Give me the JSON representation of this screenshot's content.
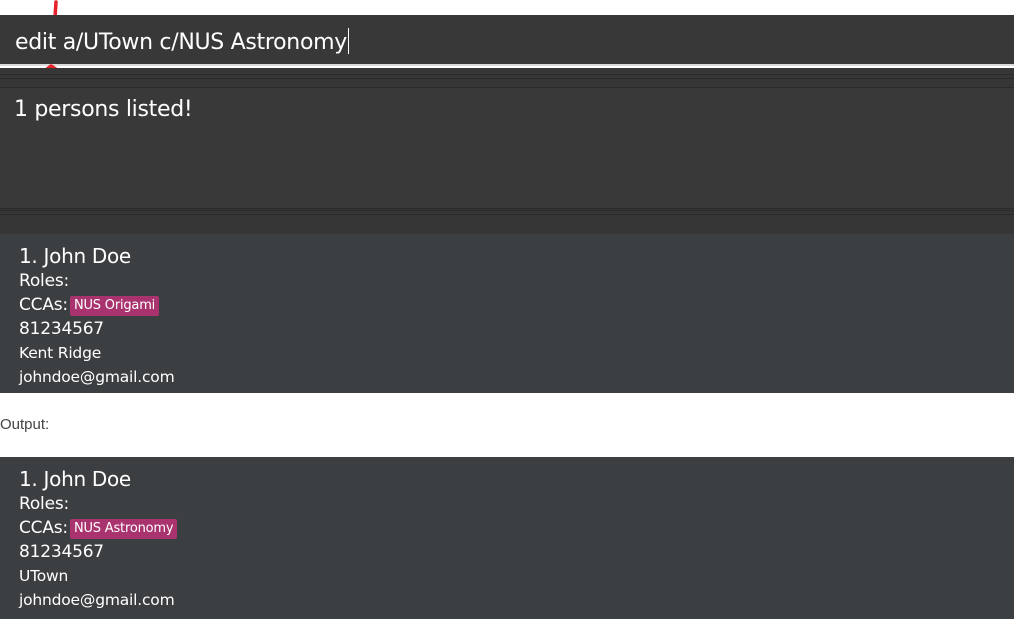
{
  "command": {
    "value": "edit a/UTown c/NUS Astronomy"
  },
  "result": {
    "message": "1 persons listed!"
  },
  "before_card": {
    "index_name": "1.  John Doe",
    "roles_label": "Roles:",
    "ccas_label": "CCAs:",
    "cca_tag": "NUS Origami",
    "phone": "81234567",
    "address": "Kent Ridge",
    "email": "johndoe@gmail.com"
  },
  "output_label": "Output:",
  "after_card": {
    "index_name": "1.  John Doe",
    "roles_label": "Roles:",
    "ccas_label": "CCAs:",
    "cca_tag": "NUS Astronomy",
    "phone": "81234567",
    "address": "UTown",
    "email": "johndoe@gmail.com"
  },
  "colors": {
    "panel_dark": "#383838",
    "card_bg": "#3c3f41",
    "tag_bg": "#a8336e",
    "annotation_red": "#e8202a"
  },
  "icons": {
    "annotation_top": "red-arrow-mark-icon",
    "annotation_bottom": "red-caret-mark-icon"
  }
}
